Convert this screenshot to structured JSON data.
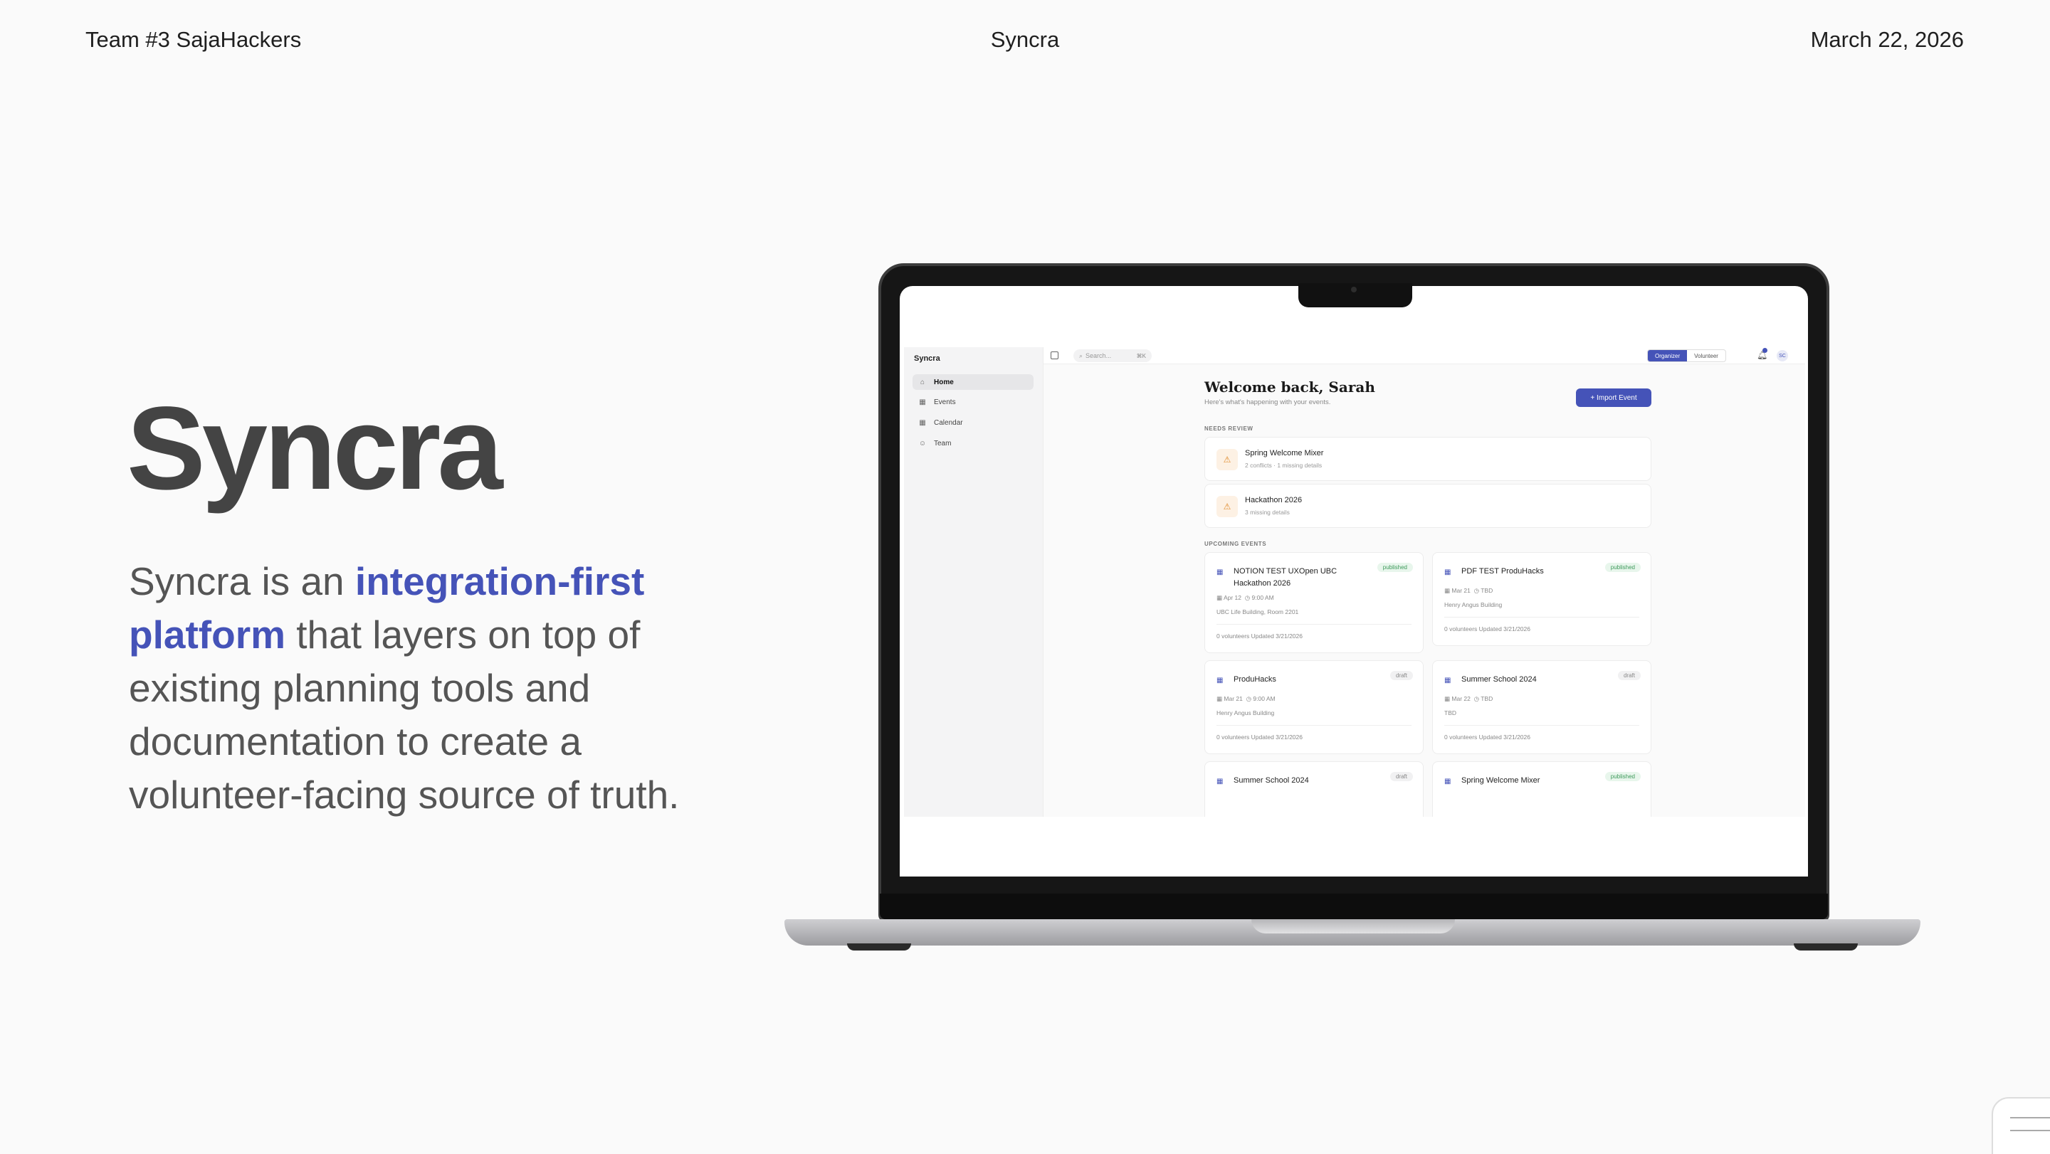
{
  "slide": {
    "header_left": "Team #3 SajaHackers",
    "header_center": "Syncra",
    "header_right": "March 22, 2026",
    "title": "Syncra",
    "desc_prefix": "Syncra is an ",
    "desc_highlight": "integration-first platform",
    "desc_suffix": " that layers on top of existing planning tools and documentation to create a volunteer-facing source of truth."
  },
  "colors": {
    "accent": "#4553b8",
    "published": "#3e9a5b",
    "warning": "#e08a2b"
  },
  "app": {
    "brand": "Syncra",
    "nav": [
      {
        "label": "Home",
        "icon": "home-icon",
        "active": true
      },
      {
        "label": "Events",
        "icon": "calendar-icon",
        "active": false
      },
      {
        "label": "Calendar",
        "icon": "calendar-icon",
        "active": false
      },
      {
        "label": "Team",
        "icon": "user-icon",
        "active": false
      }
    ],
    "search_placeholder": "Search...",
    "search_shortcut": "⌘K",
    "roles": {
      "organizer": "Organizer",
      "volunteer": "Volunteer"
    },
    "avatar_initials": "SC",
    "welcome": "Welcome back, Sarah",
    "welcome_sub": "Here's what's happening with your events.",
    "import_button": "+ Import Event",
    "needs_review_label": "NEEDS REVIEW",
    "needs_review": [
      {
        "title": "Spring Welcome Mixer",
        "subtitle": "2 conflicts · 1 missing details"
      },
      {
        "title": "Hackathon 2026",
        "subtitle": "3 missing details"
      }
    ],
    "upcoming_label": "UPCOMING EVENTS",
    "events": [
      {
        "name": "NOTION TEST UXOpen UBC Hackathon 2026",
        "status": "published",
        "date": "Apr 12",
        "time": "9:00 AM",
        "location": "UBC Life Building, Room 2201",
        "footer": "0 volunteers   Updated 3/21/2026"
      },
      {
        "name": "PDF TEST ProduHacks",
        "status": "published",
        "date": "Mar 21",
        "time": "TBD",
        "location": "Henry Angus Building",
        "footer": "0 volunteers   Updated 3/21/2026"
      },
      {
        "name": "ProduHacks",
        "status": "draft",
        "date": "Mar 21",
        "time": "9:00 AM",
        "location": "Henry Angus Building",
        "footer": "0 volunteers   Updated 3/21/2026"
      },
      {
        "name": "Summer School 2024",
        "status": "draft",
        "date": "Mar 22",
        "time": "TBD",
        "location": "TBD",
        "footer": "0 volunteers   Updated 3/21/2026"
      },
      {
        "name": "Summer School 2024",
        "status": "draft"
      },
      {
        "name": "Spring Welcome Mixer",
        "status": "published"
      }
    ]
  }
}
